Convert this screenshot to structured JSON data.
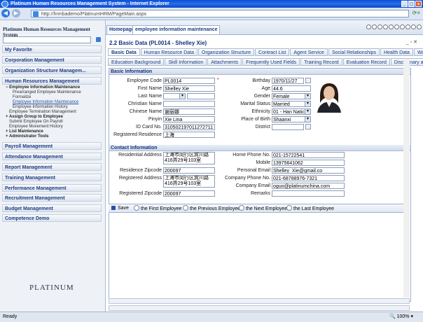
{
  "window": {
    "title": "Platinum Human Resources Management System - Internet Explorer"
  },
  "address": {
    "url": "http://hrmbademo/PlatinumHRM/PageMain.aspx"
  },
  "sidebar": {
    "title": "Platinum Human Resources Management System",
    "menus": [
      "My Favorite",
      "Corporation Management",
      "Organization Structure Managem...",
      "Human Resources Management",
      "Payroll Management",
      "Attendance Management",
      "Report Management",
      "Training Management",
      "Performance Management",
      "Recruitment Management",
      "Budget Management",
      "Competence Demo"
    ],
    "subitems": [
      "Employee Information Maintenance",
      "Prearranged Employee Maintenance",
      "Formalize",
      "Employee Information Maintenance",
      "Employee Information History",
      "Employee Termination Management",
      "Assign Group to Employee",
      "Submit Employee On Payroll",
      "Employee Movement History",
      "List Maintenance",
      "Administrator Tools"
    ],
    "logo": "PLATINUM"
  },
  "toptabs": {
    "home": "Homepage",
    "active": "employee information maintenance"
  },
  "page": {
    "title": "2.2 Basic Data (PL0014 - Shelley Xie)"
  },
  "tabs1": [
    "Basic Data",
    "Human Resource Data",
    "Organization Structure",
    "Contract List",
    "Agent Service",
    "Social Relationships",
    "Health Data",
    "Work Ex"
  ],
  "tabs2": [
    "Education Background",
    "Skill Information",
    "Attachments",
    "Frequently Used Fields",
    "Training Record",
    "Evaluation Record",
    "Disciplinary and Aw"
  ],
  "basic": {
    "section": "Basic Information",
    "employee_code_label": "Employee Code",
    "employee_code": "PL0014",
    "first_name_label": "First Name",
    "first_name": "Shelley Xie",
    "last_name_label": "Last Name",
    "christian_label": "Christian Name",
    "chinese_label": "Chinese Name",
    "chinese": "谢丽娜",
    "pinyin_label": "Pinyin",
    "pinyin": "Xie Lina",
    "idcard_label": "ID Card No.",
    "idcard": "310502197011272711",
    "registered_label": "Registered Residence",
    "registered": "上海",
    "birthday_label": "Birthday",
    "birthday": "1970/11/27",
    "age_label": "Age",
    "age": "44.6",
    "gender_label": "Gender",
    "gender": "Female",
    "marital_label": "Marital Status",
    "marital": "Married",
    "ethnicity_label": "Ethnicity",
    "ethnicity": "01 - Han Natic",
    "pob_label": "Place of Birth",
    "pob": "Shaanxi",
    "district_label": "District"
  },
  "contact": {
    "section": "Contact Information",
    "res_addr_label": "Residential Address",
    "res_addr": "上海市闵行区宾川路416弄29号103室",
    "res_zip_label": "Residence Zipcode",
    "res_zip": "200097",
    "reg_addr_label": "Registered Address",
    "reg_addr": "上海市闵行区宾川路416弄29号103室",
    "reg_zip_label": "Registered Zipcode",
    "reg_zip": "200097",
    "home_label": "Home Phone No.",
    "home": "021-15722541",
    "mobile_label": "Mobile",
    "mobile": "13975641062",
    "pemail_label": "Personal Email",
    "pemail": "Shelley_Xie@gmail.co",
    "cphone_label": "Company Phone No.",
    "cphone": "021-68788976-7321",
    "cemail_label": "Company Email",
    "cemail": "oguo@platinumchina.com",
    "remarks_label": "Remarks"
  },
  "actions": {
    "save": "Save",
    "first": "the First Employee",
    "prev": "the Previous Employee",
    "next": "the Next Employee",
    "last": "the Last Employee"
  },
  "status": {
    "left": "Ready",
    "zoom": "100%"
  }
}
